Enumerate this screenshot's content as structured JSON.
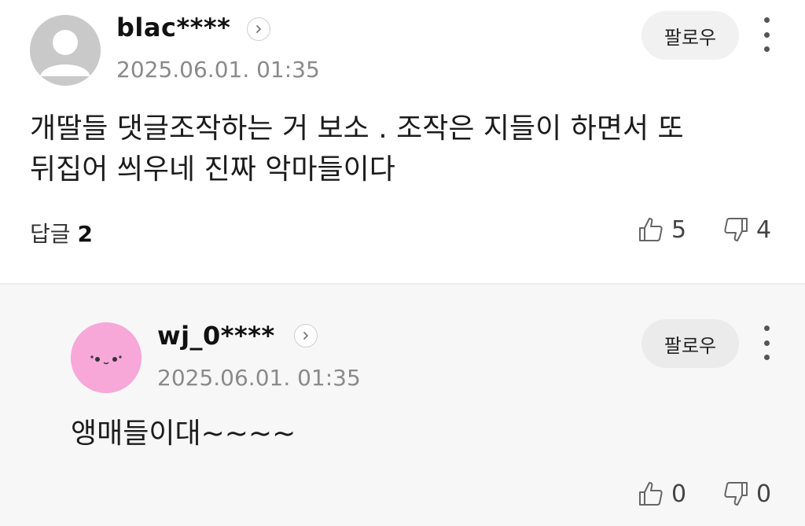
{
  "comments": [
    {
      "author": "blac****",
      "timestamp": "2025.06.01. 01:35",
      "follow_label": "팔로우",
      "body": "개딸들 댓글조작하는 거 보소 . 조작은 지들이 하면서 또\n뒤집어 씌우네 진짜 악마들이다",
      "replies_label": "답글",
      "replies_count": "2",
      "likes": "5",
      "dislikes": "4",
      "avatar_icon": "default-user-icon"
    },
    {
      "author": "wj_0****",
      "timestamp": "2025.06.01. 01:35",
      "follow_label": "팔로우",
      "body": "앵매들이대~~~~",
      "likes": "0",
      "dislikes": "0",
      "avatar_icon": "pink-face-icon"
    }
  ],
  "colors": {
    "background": "#ffffff",
    "reply_background": "#f7f7f8",
    "avatar_pink": "#f7a8d8",
    "avatar_gray": "#c8c8c8",
    "follow_button": "#f1f1f2",
    "timestamp": "#8a8a8a"
  }
}
